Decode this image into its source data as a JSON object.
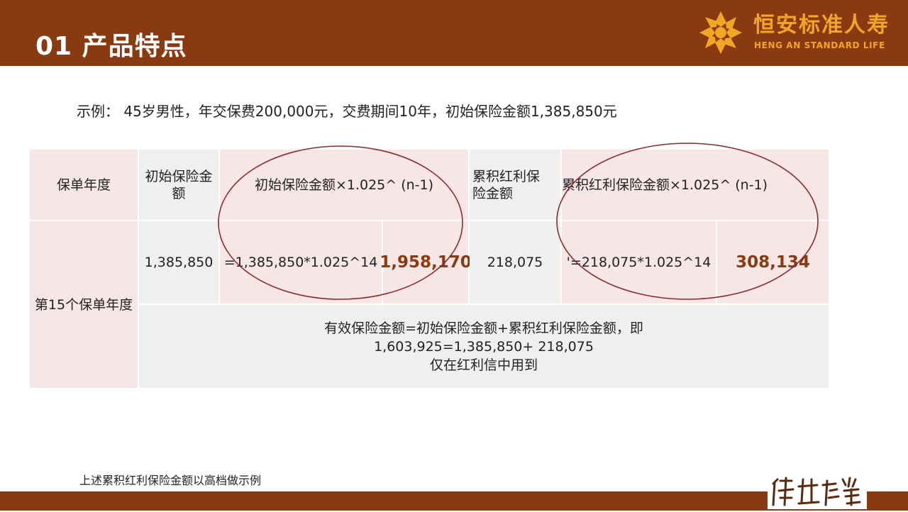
{
  "header": {
    "title": "01 产品特点",
    "logo_cn": "恒安标准人寿",
    "logo_en": "HENG AN STANDARD LIFE"
  },
  "example": "示例： 45岁男性，年交保费200,000元，交费期间10年，初始保险金额1,385,850元",
  "table": {
    "headers": {
      "policy_year": "保单年度",
      "initial_amount": "初始保险金额",
      "initial_formula": "初始保险金额×1.025^ (n-1)",
      "bonus_amount": "累积红利保险金额",
      "bonus_formula": "累积红利保险金额×1.025^ (n-1)"
    },
    "row": {
      "policy_year": "第15个保单年度",
      "initial_amount": "1,385,850",
      "initial_calc": "=1,385,850*1.025^14",
      "initial_result": "1,958,170",
      "bonus_amount": "218,075",
      "bonus_calc": "'=218,075*1.025^14",
      "bonus_result": "308,134"
    },
    "summary": {
      "line1": "有效保险金额=初始保险金额+累积红利保险金额，即",
      "line2": "1,603,925=1,385,850+ 218,075",
      "line3": "仅在红利信中用到"
    }
  },
  "footnote": "上述累积红利保险金额以高档做示例",
  "colors": {
    "brand_brown": "#8a3a10",
    "logo_gold": "#f2a623",
    "cell_pink": "#f7e6e6",
    "cell_grey": "#efefef",
    "ellipse": "#8b2a2a"
  }
}
